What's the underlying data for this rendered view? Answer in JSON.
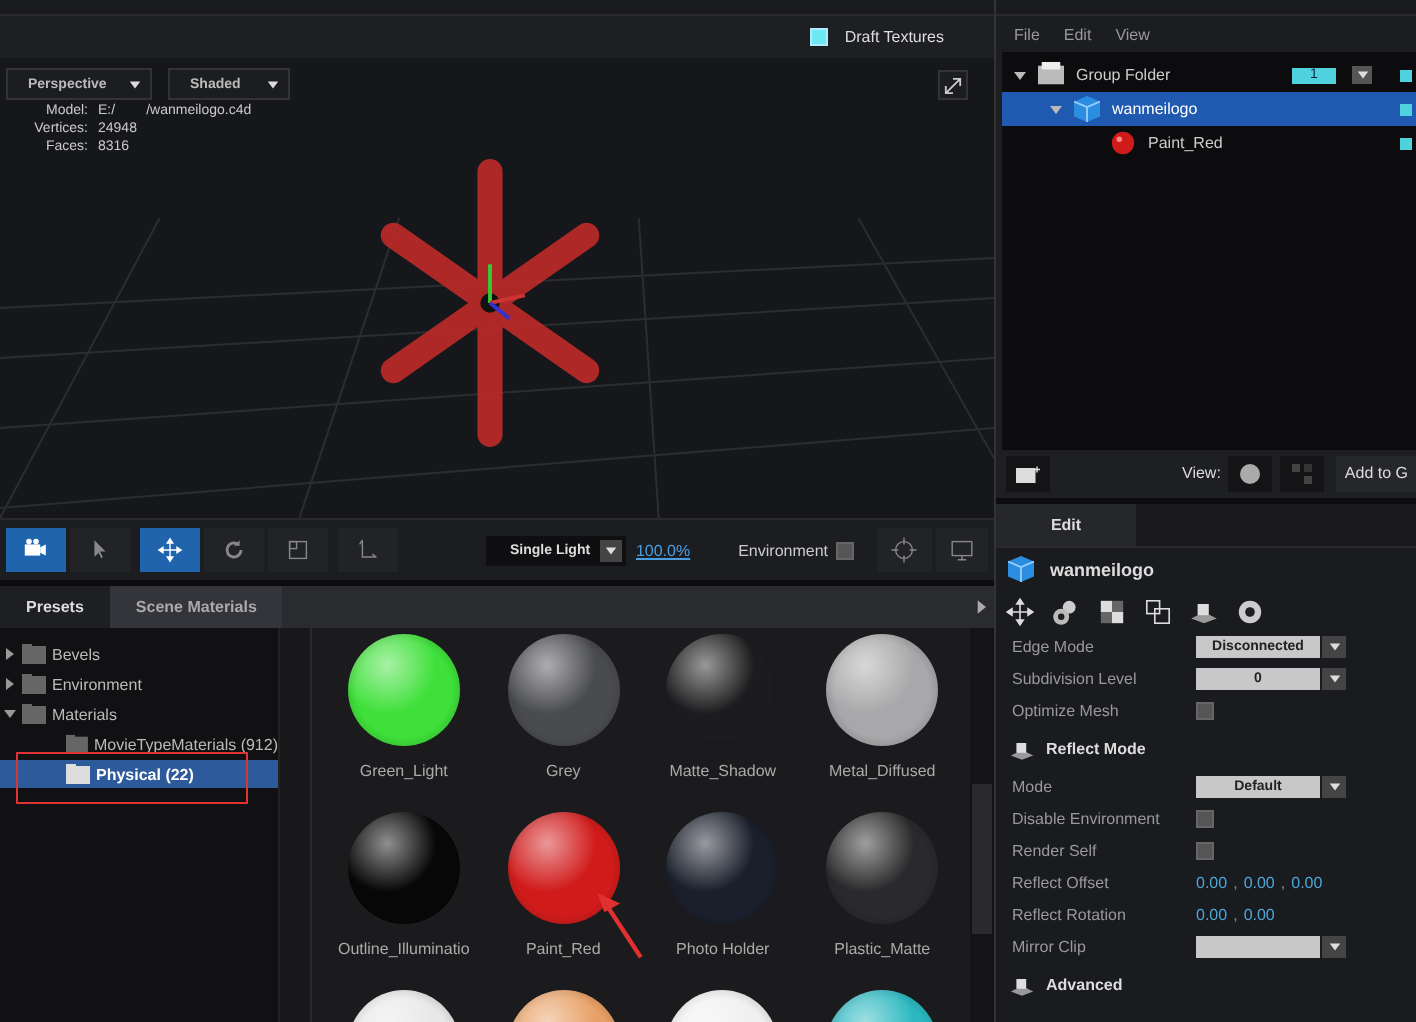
{
  "viewport": {
    "draft_textures": {
      "label": "Draft Textures",
      "checked": true
    },
    "camera_menu": "Perspective",
    "shading_menu": "Shaded",
    "info": [
      {
        "label": "Model:",
        "value": "E:/        /wanmeilogo.c4d"
      },
      {
        "label": "Vertices:",
        "value": "24948"
      },
      {
        "label": "Faces:",
        "value": "8316"
      }
    ]
  },
  "toolbar": {
    "tools": [
      {
        "kind": "camera",
        "selected": true
      },
      {
        "kind": "pointer",
        "selected": false
      },
      {
        "kind": "move",
        "selected": true
      },
      {
        "kind": "rotate",
        "selected": false
      },
      {
        "kind": "scale",
        "selected": false
      },
      {
        "kind": "axis",
        "selected": false
      }
    ],
    "light_menu": "Single Light",
    "zoom": "100.0%",
    "environment": {
      "label": "Environment",
      "checked": false
    }
  },
  "browser_tabs": [
    {
      "label": "Presets",
      "selected": true
    },
    {
      "label": "Scene Materials",
      "selected": false
    }
  ],
  "preset_tree": [
    {
      "label": "Bevels",
      "expanded": false,
      "selected": false
    },
    {
      "label": "Environment",
      "expanded": false,
      "selected": false
    },
    {
      "label": "Materials",
      "expanded": true,
      "selected": false,
      "children": [
        {
          "label": "MovieTypeMaterials (912)",
          "selected": false
        },
        {
          "label": "Physical (22)",
          "selected": true
        }
      ]
    }
  ],
  "materials": [
    {
      "name": "Green_Light",
      "color": "#3fe03a"
    },
    {
      "name": "Grey",
      "color": "#4a4b4e"
    },
    {
      "name": "Matte_Shadow",
      "color": "#1c1c1e"
    },
    {
      "name": "Metal_Diffused",
      "color": "#a8a8aa"
    },
    {
      "name": "Outline_Illuminatio",
      "color": "#070707"
    },
    {
      "name": "Paint_Red",
      "color": "#d11b1b"
    },
    {
      "name": "Photo Holder",
      "color": "#1a1f2c"
    },
    {
      "name": "Plastic_Matte",
      "color": "#2a2a2c"
    },
    {
      "color": "#e8e8e8"
    },
    {
      "color": "#e8a066"
    },
    {
      "color": "#f0f0f0"
    },
    {
      "color": "#2bb8c0"
    }
  ],
  "scene": {
    "menu": [
      "File",
      "Edit",
      "View"
    ],
    "tree": [
      {
        "kind": "folder",
        "label": "Group Folder",
        "badge": "1",
        "expanded": true,
        "selected": false,
        "children": [
          {
            "kind": "model",
            "label": "wanmeilogo",
            "expanded": true,
            "selected": true,
            "children": [
              {
                "kind": "material",
                "label": "Paint_Red",
                "selected": false
              }
            ]
          }
        ]
      }
    ],
    "view_label": "View:",
    "add_button": "Add to G"
  },
  "edit": {
    "tab": "Edit",
    "object": "wanmeilogo",
    "properties": [
      {
        "kind": "dropdown",
        "label": "Edge Mode",
        "value": "Disconnected"
      },
      {
        "kind": "dropdown",
        "label": "Subdivision Level",
        "value": "0"
      },
      {
        "kind": "checkbox",
        "label": "Optimize Mesh",
        "checked": false
      },
      {
        "kind": "section",
        "label": "Reflect Mode"
      },
      {
        "kind": "dropdown",
        "label": "Mode",
        "value": "Default"
      },
      {
        "kind": "checkbox",
        "label": "Disable Environment",
        "checked": false
      },
      {
        "kind": "checkbox",
        "label": "Render Self",
        "checked": false
      },
      {
        "kind": "vector",
        "label": "Reflect Offset",
        "separator": ",",
        "values": [
          "0.00",
          "0.00",
          "0.00"
        ]
      },
      {
        "kind": "vector",
        "label": "Reflect Rotation",
        "separator": ",",
        "values": [
          "0.00",
          "0.00"
        ]
      },
      {
        "kind": "dropdown",
        "label": "Mirror Clip"
      },
      {
        "kind": "section",
        "label": "Advanced"
      }
    ]
  }
}
